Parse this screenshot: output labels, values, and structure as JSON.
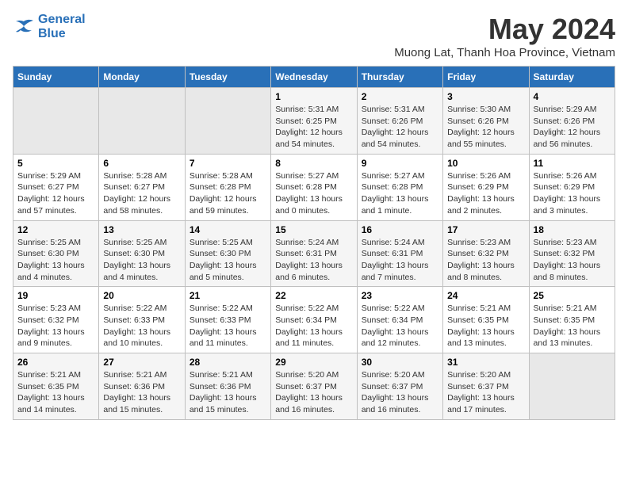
{
  "logo": {
    "line1": "General",
    "line2": "Blue"
  },
  "title": "May 2024",
  "subtitle": "Muong Lat, Thanh Hoa Province, Vietnam",
  "weekdays": [
    "Sunday",
    "Monday",
    "Tuesday",
    "Wednesday",
    "Thursday",
    "Friday",
    "Saturday"
  ],
  "weeks": [
    [
      {
        "day": "",
        "info": ""
      },
      {
        "day": "",
        "info": ""
      },
      {
        "day": "",
        "info": ""
      },
      {
        "day": "1",
        "info": "Sunrise: 5:31 AM\nSunset: 6:25 PM\nDaylight: 12 hours\nand 54 minutes."
      },
      {
        "day": "2",
        "info": "Sunrise: 5:31 AM\nSunset: 6:26 PM\nDaylight: 12 hours\nand 54 minutes."
      },
      {
        "day": "3",
        "info": "Sunrise: 5:30 AM\nSunset: 6:26 PM\nDaylight: 12 hours\nand 55 minutes."
      },
      {
        "day": "4",
        "info": "Sunrise: 5:29 AM\nSunset: 6:26 PM\nDaylight: 12 hours\nand 56 minutes."
      }
    ],
    [
      {
        "day": "5",
        "info": "Sunrise: 5:29 AM\nSunset: 6:27 PM\nDaylight: 12 hours\nand 57 minutes."
      },
      {
        "day": "6",
        "info": "Sunrise: 5:28 AM\nSunset: 6:27 PM\nDaylight: 12 hours\nand 58 minutes."
      },
      {
        "day": "7",
        "info": "Sunrise: 5:28 AM\nSunset: 6:28 PM\nDaylight: 12 hours\nand 59 minutes."
      },
      {
        "day": "8",
        "info": "Sunrise: 5:27 AM\nSunset: 6:28 PM\nDaylight: 13 hours\nand 0 minutes."
      },
      {
        "day": "9",
        "info": "Sunrise: 5:27 AM\nSunset: 6:28 PM\nDaylight: 13 hours\nand 1 minute."
      },
      {
        "day": "10",
        "info": "Sunrise: 5:26 AM\nSunset: 6:29 PM\nDaylight: 13 hours\nand 2 minutes."
      },
      {
        "day": "11",
        "info": "Sunrise: 5:26 AM\nSunset: 6:29 PM\nDaylight: 13 hours\nand 3 minutes."
      }
    ],
    [
      {
        "day": "12",
        "info": "Sunrise: 5:25 AM\nSunset: 6:30 PM\nDaylight: 13 hours\nand 4 minutes."
      },
      {
        "day": "13",
        "info": "Sunrise: 5:25 AM\nSunset: 6:30 PM\nDaylight: 13 hours\nand 4 minutes."
      },
      {
        "day": "14",
        "info": "Sunrise: 5:25 AM\nSunset: 6:30 PM\nDaylight: 13 hours\nand 5 minutes."
      },
      {
        "day": "15",
        "info": "Sunrise: 5:24 AM\nSunset: 6:31 PM\nDaylight: 13 hours\nand 6 minutes."
      },
      {
        "day": "16",
        "info": "Sunrise: 5:24 AM\nSunset: 6:31 PM\nDaylight: 13 hours\nand 7 minutes."
      },
      {
        "day": "17",
        "info": "Sunrise: 5:23 AM\nSunset: 6:32 PM\nDaylight: 13 hours\nand 8 minutes."
      },
      {
        "day": "18",
        "info": "Sunrise: 5:23 AM\nSunset: 6:32 PM\nDaylight: 13 hours\nand 8 minutes."
      }
    ],
    [
      {
        "day": "19",
        "info": "Sunrise: 5:23 AM\nSunset: 6:32 PM\nDaylight: 13 hours\nand 9 minutes."
      },
      {
        "day": "20",
        "info": "Sunrise: 5:22 AM\nSunset: 6:33 PM\nDaylight: 13 hours\nand 10 minutes."
      },
      {
        "day": "21",
        "info": "Sunrise: 5:22 AM\nSunset: 6:33 PM\nDaylight: 13 hours\nand 11 minutes."
      },
      {
        "day": "22",
        "info": "Sunrise: 5:22 AM\nSunset: 6:34 PM\nDaylight: 13 hours\nand 11 minutes."
      },
      {
        "day": "23",
        "info": "Sunrise: 5:22 AM\nSunset: 6:34 PM\nDaylight: 13 hours\nand 12 minutes."
      },
      {
        "day": "24",
        "info": "Sunrise: 5:21 AM\nSunset: 6:35 PM\nDaylight: 13 hours\nand 13 minutes."
      },
      {
        "day": "25",
        "info": "Sunrise: 5:21 AM\nSunset: 6:35 PM\nDaylight: 13 hours\nand 13 minutes."
      }
    ],
    [
      {
        "day": "26",
        "info": "Sunrise: 5:21 AM\nSunset: 6:35 PM\nDaylight: 13 hours\nand 14 minutes."
      },
      {
        "day": "27",
        "info": "Sunrise: 5:21 AM\nSunset: 6:36 PM\nDaylight: 13 hours\nand 15 minutes."
      },
      {
        "day": "28",
        "info": "Sunrise: 5:21 AM\nSunset: 6:36 PM\nDaylight: 13 hours\nand 15 minutes."
      },
      {
        "day": "29",
        "info": "Sunrise: 5:20 AM\nSunset: 6:37 PM\nDaylight: 13 hours\nand 16 minutes."
      },
      {
        "day": "30",
        "info": "Sunrise: 5:20 AM\nSunset: 6:37 PM\nDaylight: 13 hours\nand 16 minutes."
      },
      {
        "day": "31",
        "info": "Sunrise: 5:20 AM\nSunset: 6:37 PM\nDaylight: 13 hours\nand 17 minutes."
      },
      {
        "day": "",
        "info": ""
      }
    ]
  ]
}
